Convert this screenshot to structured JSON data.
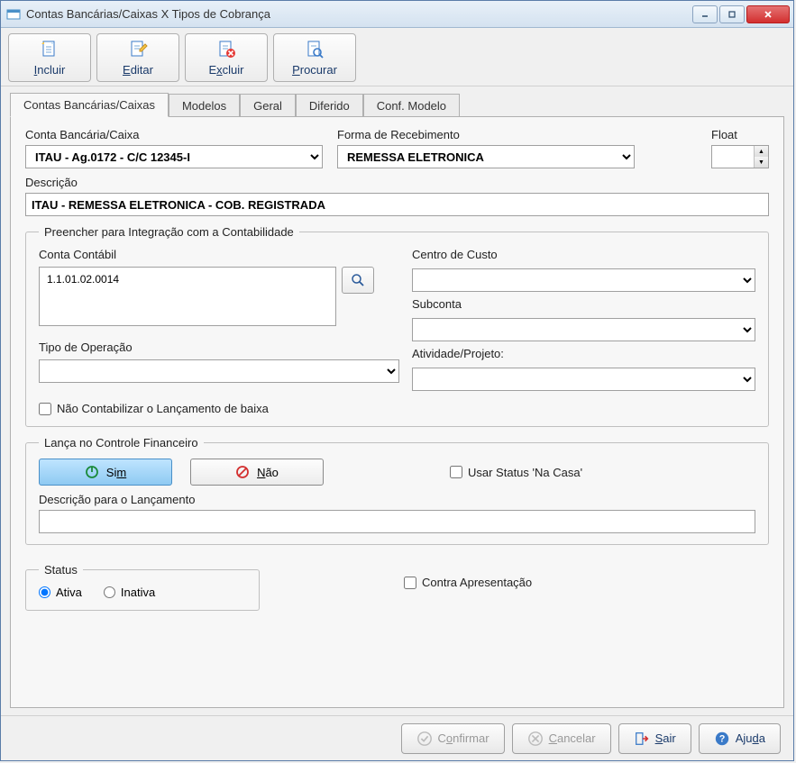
{
  "titlebar": {
    "title": "Contas Bancárias/Caixas X Tipos de Cobrança"
  },
  "toolbar": {
    "incluir": "Incluir",
    "editar": "Editar",
    "excluir": "Excluir",
    "procurar": "Procurar"
  },
  "tabs": {
    "t0": "Contas Bancárias/Caixas",
    "t1": "Modelos",
    "t2": "Geral",
    "t3": "Diferido",
    "t4": "Conf. Modelo"
  },
  "labels": {
    "conta_bancaria": "Conta Bancária/Caixa",
    "forma_recebimento": "Forma de Recebimento",
    "float": "Float",
    "descricao": "Descrição",
    "preencher_group": "Preencher para Integração com a Contabilidade",
    "conta_contabil": "Conta Contábil",
    "centro_custo": "Centro de Custo",
    "subconta": "Subconta",
    "atividade": "Atividade/Projeto:",
    "tipo_operacao": "Tipo de Operação",
    "nao_contabilizar": "Não Contabilizar o Lançamento de baixa",
    "lanca_group": "Lança no Controle Financeiro",
    "sim": "Sim",
    "nao": "Não",
    "usar_status": "Usar Status 'Na Casa'",
    "descricao_lanc": "Descrição para o Lançamento",
    "status": "Status",
    "ativa": "Ativa",
    "inativa": "Inativa",
    "contra": "Contra Apresentação"
  },
  "values": {
    "conta_bancaria": "ITAU - Ag.0172 - C/C 12345-I",
    "forma_recebimento": "REMESSA ELETRONICA",
    "float": "",
    "descricao": "ITAU - REMESSA ELETRONICA - COB. REGISTRADA",
    "conta_contabil": "1.1.01.02.0014",
    "centro_custo": "",
    "subconta": "",
    "atividade": "",
    "tipo_operacao": "",
    "nao_contabilizar": false,
    "lanca_sim": true,
    "usar_status": false,
    "descricao_lanc": "",
    "status": "ativa",
    "contra": false
  },
  "bottom": {
    "confirmar": "Confirmar",
    "cancelar": "Cancelar",
    "sair": "Sair",
    "ajuda": "Ajuda"
  }
}
